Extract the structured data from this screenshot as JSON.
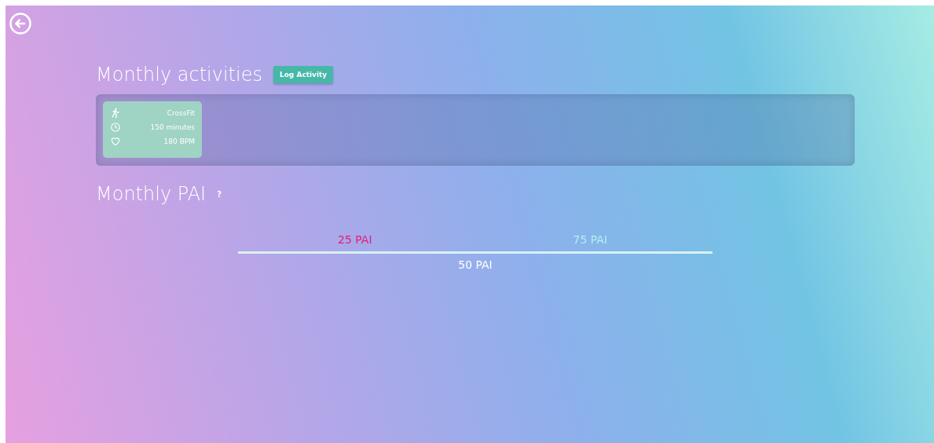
{
  "activities_section": {
    "title": "Monthly activities",
    "button": "Log Activity"
  },
  "activities": [
    {
      "name": "CrossFit",
      "duration": "150 minutes",
      "heart_rate": "180 BPM"
    }
  ],
  "pai_section": {
    "title": "Monthly PAI",
    "help": "?"
  },
  "pai_scale": {
    "low": "25 PAI",
    "high": "75 PAI",
    "current": "50 PAI"
  }
}
